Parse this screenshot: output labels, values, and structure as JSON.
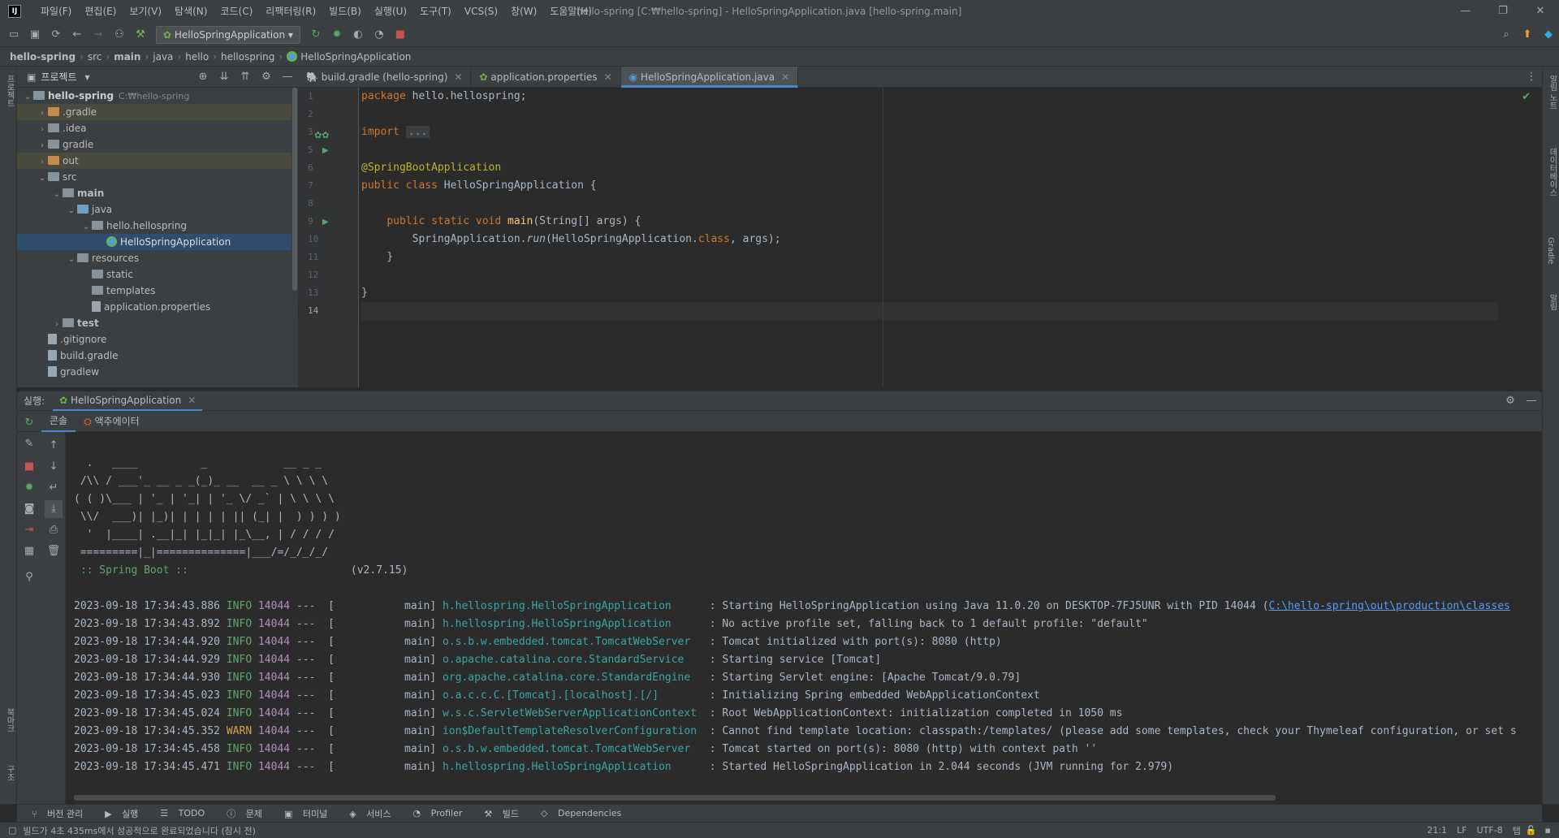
{
  "app": {
    "menu": [
      "파일(F)",
      "편집(E)",
      "보기(V)",
      "탐색(N)",
      "코드(C)",
      "리팩터링(R)",
      "빌드(B)",
      "실행(U)",
      "도구(T)",
      "VCS(S)",
      "창(W)",
      "도움말(H)"
    ],
    "window_title": "hello-spring [C:₩hello-spring] - HelloSpringApplication.java [hello-spring.main]"
  },
  "toolbar": {
    "run_config": "HelloSpringApplication"
  },
  "breadcrumbs": [
    "hello-spring",
    "src",
    "main",
    "java",
    "hello",
    "hellospring",
    "HelloSpringApplication"
  ],
  "project": {
    "title": "프로젝트",
    "root": "hello-spring",
    "root_path": "C:₩hello-spring",
    "items": [
      {
        "label": ".gradle",
        "depth": 1,
        "arrow": "›",
        "icon": "folder orange",
        "hl": true
      },
      {
        "label": ".idea",
        "depth": 1,
        "arrow": "›",
        "icon": "folder",
        "hl": false
      },
      {
        "label": "gradle",
        "depth": 1,
        "arrow": "›",
        "icon": "folder",
        "hl": false
      },
      {
        "label": "out",
        "depth": 1,
        "arrow": "›",
        "icon": "folder orange",
        "hl": true
      },
      {
        "label": "src",
        "depth": 1,
        "arrow": "⌄",
        "icon": "folder",
        "hl": false
      },
      {
        "label": "main",
        "depth": 2,
        "arrow": "⌄",
        "icon": "folder",
        "hl": false
      },
      {
        "label": "java",
        "depth": 3,
        "arrow": "⌄",
        "icon": "folder blue",
        "hl": false
      },
      {
        "label": "hello.hellospring",
        "depth": 4,
        "arrow": "⌄",
        "icon": "folder",
        "hl": false
      },
      {
        "label": "HelloSpringApplication",
        "depth": 5,
        "arrow": "",
        "icon": "spring",
        "sel": true
      },
      {
        "label": "resources",
        "depth": 3,
        "arrow": "⌄",
        "icon": "folder",
        "hl": false
      },
      {
        "label": "static",
        "depth": 4,
        "arrow": "",
        "icon": "folder",
        "hl": false
      },
      {
        "label": "templates",
        "depth": 4,
        "arrow": "",
        "icon": "folder",
        "hl": false
      },
      {
        "label": "application.properties",
        "depth": 4,
        "arrow": "",
        "icon": "file",
        "hl": false
      },
      {
        "label": "test",
        "depth": 2,
        "arrow": "›",
        "icon": "folder",
        "hl": false
      },
      {
        "label": ".gitignore",
        "depth": 1,
        "arrow": "",
        "icon": "file",
        "hl": false
      },
      {
        "label": "build.gradle",
        "depth": 1,
        "arrow": "",
        "icon": "file",
        "hl": false
      },
      {
        "label": "gradlew",
        "depth": 1,
        "arrow": "",
        "icon": "file",
        "hl": false
      }
    ]
  },
  "editor": {
    "tabs": [
      {
        "label": "build.gradle (hello-spring)",
        "active": false
      },
      {
        "label": "application.properties",
        "active": false
      },
      {
        "label": "HelloSpringApplication.java",
        "active": true
      }
    ],
    "line_numbers": [
      "1",
      "2",
      "3",
      "5",
      "6",
      "7",
      "8",
      "9",
      "10",
      "11",
      "12",
      "13",
      "14"
    ]
  },
  "run": {
    "label": "실행:",
    "config": "HelloSpringApplication",
    "tabs": [
      "콘솔",
      "액추에이터"
    ],
    "banner": [
      "  .   ____          _            __ _ _",
      " /\\\\ / ___'_ __ _ _(_)_ __  __ _ \\ \\ \\ \\",
      "( ( )\\___ | '_ | '_| | '_ \\/ _` | \\ \\ \\ \\",
      " \\\\/  ___)| |_)| | | | | || (_| |  ) ) ) )",
      "  '  |____| .__|_| |_|_| |_\\__, | / / / /",
      " =========|_|==============|___/=/_/_/_/"
    ],
    "boot_label": " :: Spring Boot ::",
    "boot_version": "(v2.7.15)",
    "logs": [
      {
        "ts": "2023-09-18 17:34:43.886",
        "level": "INFO",
        "pid": "14044",
        "thread": "---  [           main]",
        "logger": "h.hellospring.HelloSpringApplication    ",
        "msg": " : Starting HelloSpringApplication using Java 11.0.20 on DESKTOP-7FJ5UNR with PID 14044 (",
        "link": "C:\\hello-spring\\out\\production\\classes"
      },
      {
        "ts": "2023-09-18 17:34:43.892",
        "level": "INFO",
        "pid": "14044",
        "thread": "---  [           main]",
        "logger": "h.hellospring.HelloSpringApplication    ",
        "msg": " : No active profile set, falling back to 1 default profile: \"default\"",
        "link": ""
      },
      {
        "ts": "2023-09-18 17:34:44.920",
        "level": "INFO",
        "pid": "14044",
        "thread": "---  [           main]",
        "logger": "o.s.b.w.embedded.tomcat.TomcatWebServer ",
        "msg": " : Tomcat initialized with port(s): 8080 (http)",
        "link": ""
      },
      {
        "ts": "2023-09-18 17:34:44.929",
        "level": "INFO",
        "pid": "14044",
        "thread": "---  [           main]",
        "logger": "o.apache.catalina.core.StandardService  ",
        "msg": " : Starting service [Tomcat]",
        "link": ""
      },
      {
        "ts": "2023-09-18 17:34:44.930",
        "level": "INFO",
        "pid": "14044",
        "thread": "---  [           main]",
        "logger": "org.apache.catalina.core.StandardEngine ",
        "msg": " : Starting Servlet engine: [Apache Tomcat/9.0.79]",
        "link": ""
      },
      {
        "ts": "2023-09-18 17:34:45.023",
        "level": "INFO",
        "pid": "14044",
        "thread": "---  [           main]",
        "logger": "o.a.c.c.C.[Tomcat].[localhost].[/]      ",
        "msg": " : Initializing Spring embedded WebApplicationContext",
        "link": ""
      },
      {
        "ts": "2023-09-18 17:34:45.024",
        "level": "INFO",
        "pid": "14044",
        "thread": "---  [           main]",
        "logger": "w.s.c.ServletWebServerApplicationContext",
        "msg": " : Root WebApplicationContext: initialization completed in 1050 ms",
        "link": ""
      },
      {
        "ts": "2023-09-18 17:34:45.352",
        "level": "WARN",
        "pid": "14044",
        "thread": "---  [           main]",
        "logger": "ion$DefaultTemplateResolverConfiguration",
        "msg": " : Cannot find template location: classpath:/templates/ (please add some templates, check your Thymeleaf configuration, or set s",
        "link": ""
      },
      {
        "ts": "2023-09-18 17:34:45.458",
        "level": "INFO",
        "pid": "14044",
        "thread": "---  [           main]",
        "logger": "o.s.b.w.embedded.tomcat.TomcatWebServer ",
        "msg": " : Tomcat started on port(s): 8080 (http) with context path ''",
        "link": ""
      },
      {
        "ts": "2023-09-18 17:34:45.471",
        "level": "INFO",
        "pid": "14044",
        "thread": "---  [           main]",
        "logger": "h.hellospring.HelloSpringApplication    ",
        "msg": " : Started HelloSpringApplication in 2.044 seconds (JVM running for 2.979)",
        "link": ""
      }
    ]
  },
  "tooltabs": [
    "버전 관리",
    "실행",
    "TODO",
    "문제",
    "터미널",
    "서비스",
    "Profiler",
    "빌드",
    "Dependencies"
  ],
  "status": {
    "message": "빌드가 4초 435ms에서 성공적으로 완료되었습니다 (잠시 전)",
    "position": "21:1",
    "line_sep": "LF",
    "encoding": "UTF-8",
    "indent": "탭"
  },
  "stripes": {
    "left_top": "프로젝트",
    "left_bottom1": "북마크",
    "left_bottom2": "구조",
    "right1": "알림 노트",
    "right2": "데이터베이스",
    "right3": "Gradle",
    "right4": "알림"
  }
}
